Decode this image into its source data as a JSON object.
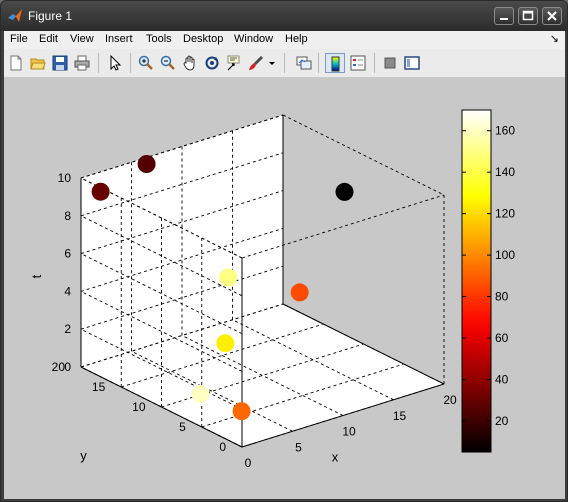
{
  "window": {
    "title": "Figure 1"
  },
  "menu": [
    "File",
    "Edit",
    "View",
    "Insert",
    "Tools",
    "Desktop",
    "Window",
    "Help"
  ],
  "toolbar_icons": [
    "new-figure-icon",
    "open-file-icon",
    "save-icon",
    "print-icon",
    "pointer-icon",
    "zoom-in-icon",
    "zoom-out-icon",
    "pan-icon",
    "rotate-3d-icon",
    "data-cursor-icon",
    "brush-icon",
    "brush-dropdown-icon",
    "link-plot-icon",
    "colorbar-icon",
    "legend-icon",
    "hide-plot-tools-icon",
    "show-plot-tools-icon"
  ],
  "chart_data": {
    "type": "scatter",
    "title": "",
    "xlabel": "x",
    "ylabel": "y",
    "zlabel": "t",
    "xlim": [
      0,
      20
    ],
    "ylim": [
      0,
      20
    ],
    "zlim": [
      0,
      10
    ],
    "xticks": [
      "0",
      "5",
      "10",
      "15",
      "20"
    ],
    "yticks": [
      "0",
      "5",
      "10",
      "15",
      "20"
    ],
    "zticks": [
      "0",
      "2",
      "4",
      "6",
      "8",
      "10"
    ],
    "grid": true,
    "box": true,
    "colormap": "hot",
    "colorbar": {
      "range": [
        5,
        170
      ],
      "ticks": [
        "20",
        "40",
        "60",
        "80",
        "100",
        "120",
        "140",
        "160"
      ]
    },
    "points": [
      {
        "x": 0.9,
        "y": 18.7,
        "z": 9.4,
        "c": 30
      },
      {
        "x": 5.7,
        "y": 19.0,
        "z": 10.0,
        "c": 25
      },
      {
        "x": 17.8,
        "y": 9.6,
        "z": 8.5,
        "c": 5
      },
      {
        "x": 14.8,
        "y": 11.4,
        "z": 3.3,
        "c": 85
      },
      {
        "x": 12.5,
        "y": 17.4,
        "z": 3.2,
        "c": 150
      },
      {
        "x": 10.3,
        "y": 15.0,
        "z": 0.6,
        "c": 125
      },
      {
        "x": 0.5,
        "y": 5.8,
        "z": 1.5,
        "c": 160
      },
      {
        "x": 0.2,
        "y": 0.3,
        "z": 1.8,
        "c": 92
      }
    ]
  }
}
